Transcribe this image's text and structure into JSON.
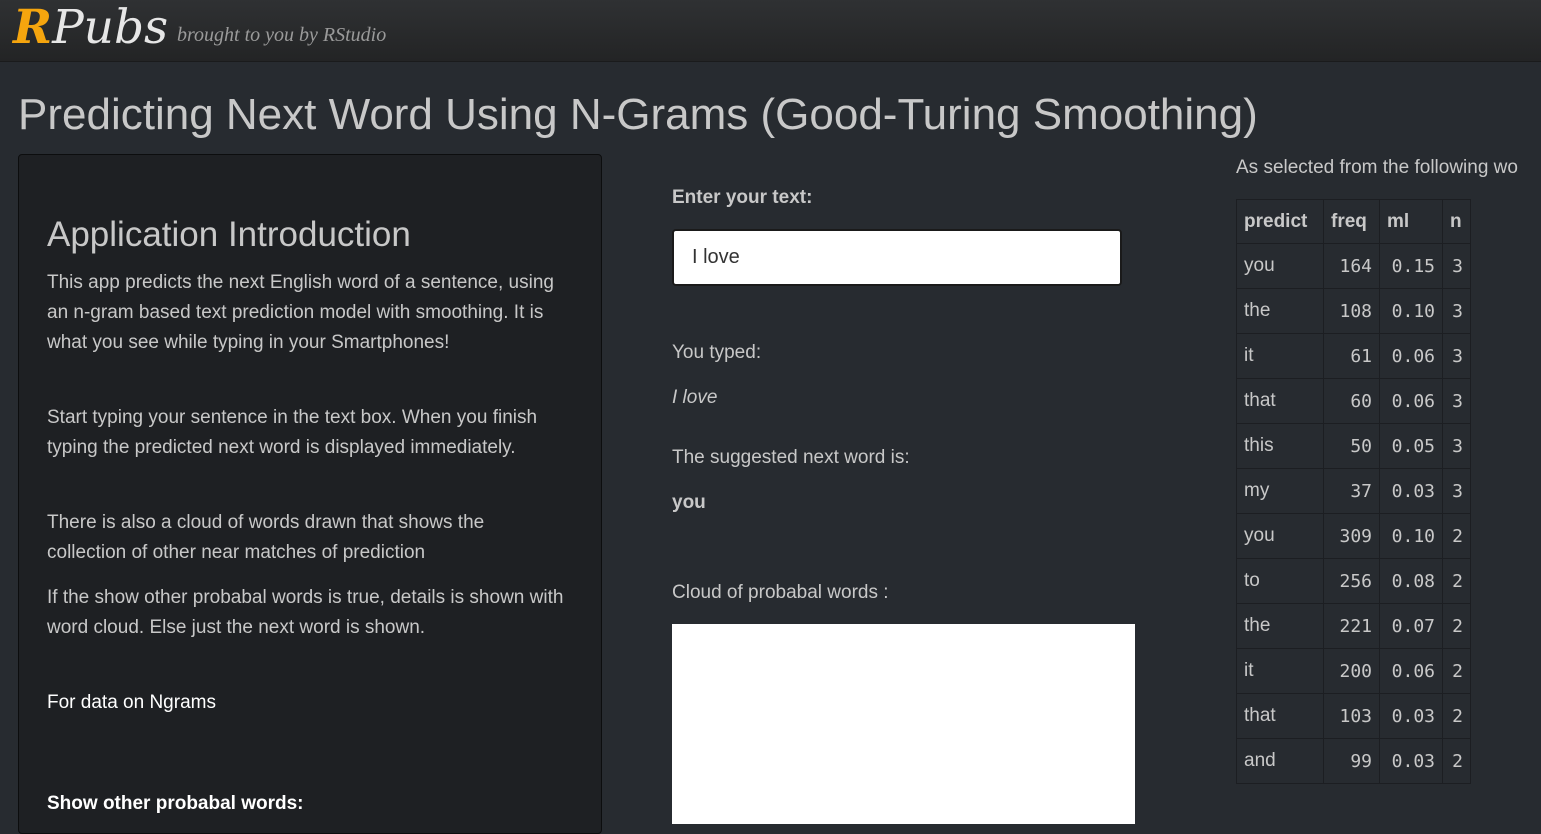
{
  "header": {
    "logo_r": "R",
    "logo_pubs": "Pubs",
    "tagline": "brought to you by RStudio"
  },
  "page": {
    "title": "Predicting Next Word Using N-Grams (Good-Turing Smoothing)"
  },
  "sidebar": {
    "heading": "Application Introduction",
    "paragraphs": [
      "This app predicts the next English word of a sentence, using an n-gram based text prediction model with smoothing. It is what you see while typing in your Smartphones!",
      "Start typing your sentence in the text box. When you finish typing the predicted next word is displayed immediately.",
      "There is also a cloud of words drawn that shows the collection of other near matches of prediction",
      "If the show other probabal words is true, details is shown with word cloud. Else just the next word is shown."
    ],
    "ngrams_link": "For data on Ngrams",
    "show_label": "Show other probabal words:"
  },
  "main": {
    "input_label": "Enter your text:",
    "input_value": "I love",
    "typed_label": "You typed:",
    "typed_value": "I love",
    "suggest_label": "The suggested next word is:",
    "suggest_value": "you",
    "cloud_label": "Cloud of probabal words :"
  },
  "table": {
    "caption": "As selected from the following wo",
    "columns": [
      "predict",
      "freq",
      "ml",
      "n"
    ],
    "rows": [
      [
        "you",
        "164",
        "0.15",
        "3"
      ],
      [
        "the",
        "108",
        "0.10",
        "3"
      ],
      [
        "it",
        "61",
        "0.06",
        "3"
      ],
      [
        "that",
        "60",
        "0.06",
        "3"
      ],
      [
        "this",
        "50",
        "0.05",
        "3"
      ],
      [
        "my",
        "37",
        "0.03",
        "3"
      ],
      [
        "you",
        "309",
        "0.10",
        "2"
      ],
      [
        "to",
        "256",
        "0.08",
        "2"
      ],
      [
        "the",
        "221",
        "0.07",
        "2"
      ],
      [
        "it",
        "200",
        "0.06",
        "2"
      ],
      [
        "that",
        "103",
        "0.03",
        "2"
      ],
      [
        "and",
        "99",
        "0.03",
        "2"
      ]
    ]
  },
  "colors": {
    "background": "#272b30",
    "accent": "#f5a50e",
    "panel": "#1e2023"
  }
}
